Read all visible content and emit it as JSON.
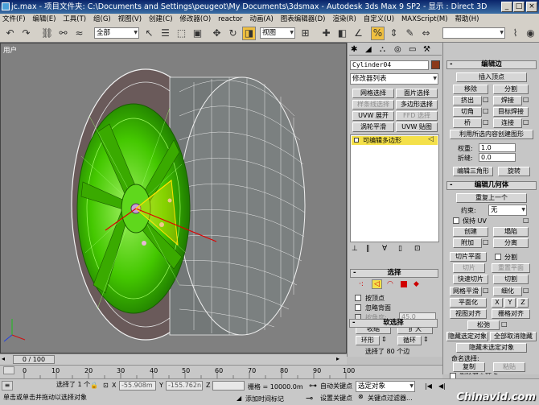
{
  "window": {
    "title": "jc.max  - 项目文件夹: C:\\Documents and Settings\\peugeot\\My Documents\\3dsmax   - Autodesk 3ds Max 9 SP2  - 显示 : Direct 3D",
    "min": "_",
    "max": "□",
    "close": "×"
  },
  "menu": [
    "文件(F)",
    "编辑(E)",
    "工具(T)",
    "组(G)",
    "视图(V)",
    "创建(C)",
    "修改器(O)",
    "reactor",
    "动画(A)",
    "图表编辑器(D)",
    "渲染(R)",
    "自定义(U)",
    "MAXScript(M)",
    "帮助(H)"
  ],
  "toolbar": {
    "selection_filter": "全部",
    "coord_system": "视图"
  },
  "viewport": {
    "label": "用户"
  },
  "command_panel": {
    "object_name": "Cylinder04",
    "modifier_list": "修改器列表",
    "btns": {
      "mesh_select": "网格选择",
      "patch_select": "面片选择",
      "sample_mesh": "样条线选择",
      "poly_select": "多边形选择",
      "uvw_expand": "UVW 展开",
      "ffd": "FFD 选择",
      "turbosmooth": "涡轮平滑",
      "uvw_map": "UVW 贴图"
    },
    "stack_item": "可编辑多边形",
    "selection_title": "选择",
    "by_vertex": "按顶点",
    "ignore_back": "忽略背面",
    "by_angle": "按角度:",
    "angle_value": "45.0",
    "shrink": "收缩",
    "grow": "扩大",
    "ring": "环形",
    "loop": "循环",
    "selected_text": "选择了 80 个边",
    "soft_select": "软选择"
  },
  "right_panel": {
    "edit_edges_title": "编辑边",
    "insert_vertex": "插入顶点",
    "remove": "移除",
    "split": "分割",
    "extrude": "挤出",
    "weld": "焊接",
    "chamfer": "切角",
    "target_weld": "目标焊接",
    "bridge": "桥",
    "connect": "连接",
    "create_shape": "利用所选内容创建图形",
    "weight_label": "权重:",
    "weight_value": "1.0",
    "crease_label": "折缝:",
    "crease_value": "0.0",
    "edit_tri": "编辑三角形",
    "turn": "旋转",
    "edit_geo_title": "编辑几何体",
    "repeat_last": "重复上一个",
    "constraint_label": "约束:",
    "constraint_value": "无",
    "preserve_uv": "保持 UV",
    "create": "创建",
    "collapse": "塌陷",
    "attach": "附加",
    "detach": "分离",
    "slice_plane": "切片平面",
    "split2": "分割",
    "slice": "切片",
    "reset_plane": "重置平面",
    "quickslice": "快速切片",
    "cut": "切割",
    "meshsmooth": "网格平滑",
    "tessellate": "细化",
    "planarize": "平面化",
    "x": "X",
    "y": "Y",
    "z": "Z",
    "view_align": "视图对齐",
    "grid_align": "栅格对齐",
    "relax": "松弛",
    "hide_selected": "隐藏选定对象",
    "unhide_all": "全部取消隐藏",
    "hide_unselected": "隐藏未选定对象",
    "named_sel": "命名选择:",
    "copy": "复制",
    "paste": "粘贴",
    "delete_iso": "删除孤立顶点"
  },
  "timeline": {
    "frame": "0 / 100",
    "ticks": [
      "0",
      "10",
      "20",
      "30",
      "40",
      "50",
      "60",
      "70",
      "80",
      "90",
      "100"
    ]
  },
  "status": {
    "selected": "选择了 1 个",
    "x_label": "X",
    "x_value": "-55.908m",
    "y_label": "Y",
    "y_value": "-155.762n",
    "z_label": "Z",
    "grid": "栅格 = 10000.0m",
    "auto_key": "自动关键点",
    "set_key": "设置关键点",
    "sel_set": "选定对象",
    "key_filters": "关键点过滤器...",
    "prompt": "单击或单击并拖动以选择对象",
    "add_time_tag": "添加时间标记"
  },
  "watermark": "Chinavid.com",
  "colors": {
    "wheel_green": "#33cc00",
    "tire_line": "#f0f0f0",
    "viewport_bg": "#808080",
    "title_blue": "#0a246a",
    "highlight_yellow": "#f4e04a"
  }
}
